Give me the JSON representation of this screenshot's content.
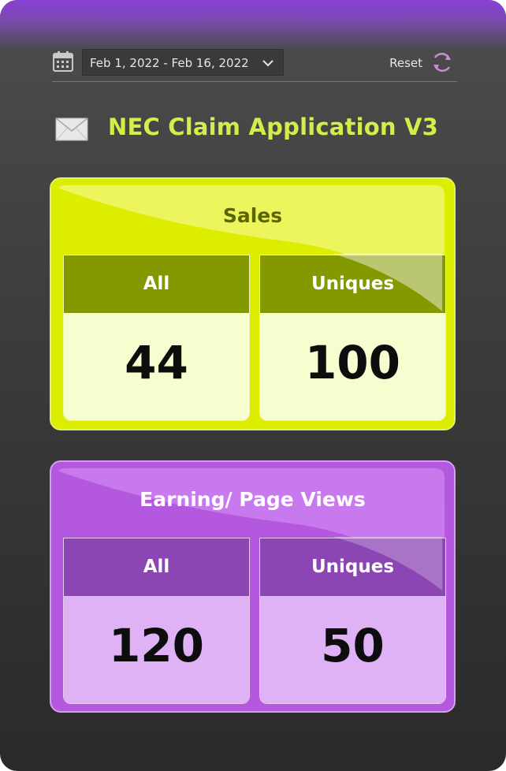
{
  "header": {
    "date_range": "Feb 1, 2022 - Feb 16, 2022",
    "reset_label": "Reset"
  },
  "app": {
    "title": "NEC Claim Application V3"
  },
  "cards": [
    {
      "title": "Sales",
      "all_label": "All",
      "all_value": "44",
      "uniques_label": "Uniques",
      "uniques_value": "100"
    },
    {
      "title": "Earning/ Page Views",
      "all_label": "All",
      "all_value": "120",
      "uniques_label": "Uniques",
      "uniques_value": "50"
    }
  ],
  "colors": {
    "accent_title": "#d6ec4a",
    "sales_card": "#dded00",
    "earning_card": "#b458e0",
    "top_bar": "#8a3fd6"
  },
  "icons": [
    "calendar-icon",
    "chevron-down-icon",
    "refresh-icon",
    "mail-icon"
  ]
}
